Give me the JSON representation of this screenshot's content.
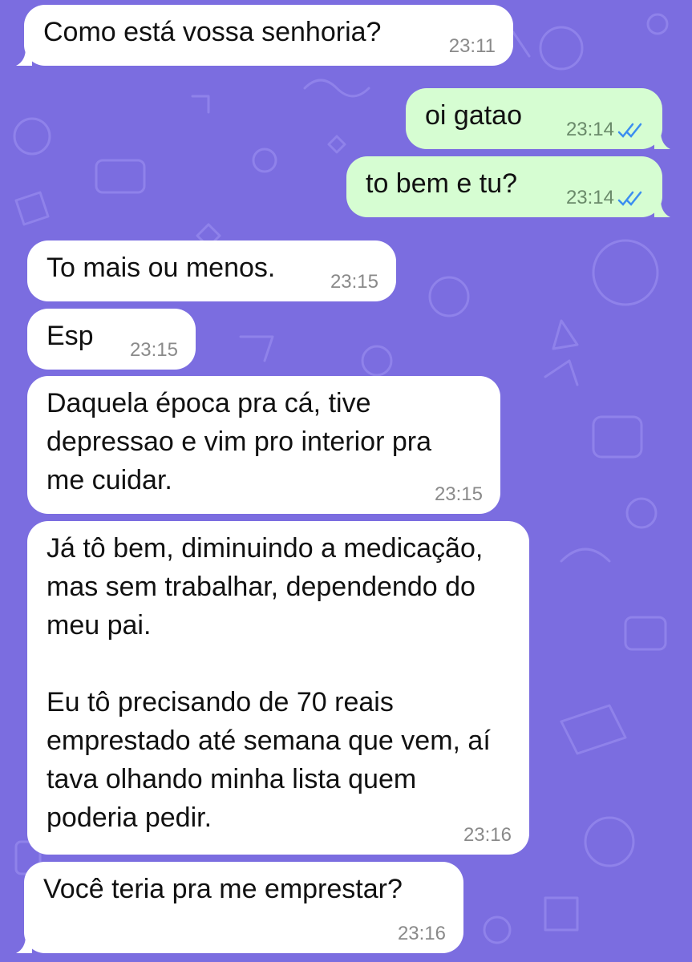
{
  "wallpaper": {
    "color": "#7b6de0",
    "doodle_color": "#8f82ea"
  },
  "messages": [
    {
      "direction": "incoming",
      "text": "Como está vossa senhoria?",
      "time": "23:11"
    },
    {
      "direction": "outgoing",
      "text": "oi gatao",
      "time": "23:14",
      "status": "read"
    },
    {
      "direction": "outgoing",
      "text": "to bem e tu?",
      "time": "23:14",
      "status": "read"
    },
    {
      "direction": "incoming",
      "text": "To mais ou menos.",
      "time": "23:15"
    },
    {
      "direction": "incoming",
      "text": "Esp",
      "time": "23:15"
    },
    {
      "direction": "incoming",
      "text": "Daquela época pra cá, tive depressao e vim pro interior pra me cuidar.",
      "time": "23:15"
    },
    {
      "direction": "incoming",
      "text": "Já tô bem, diminuindo a medicação, mas sem trabalhar, dependendo do meu pai.\n\nEu tô precisando de 70 reais emprestado até semana que vem, aí tava olhando minha lista quem poderia pedir.",
      "time": "23:16"
    },
    {
      "direction": "incoming",
      "text": "Você teria pra me emprestar?",
      "time": "23:16"
    }
  ],
  "colors": {
    "incoming_bubble": "#ffffff",
    "outgoing_bubble": "#d6fdd2",
    "read_ticks": "#3b8ef0"
  }
}
